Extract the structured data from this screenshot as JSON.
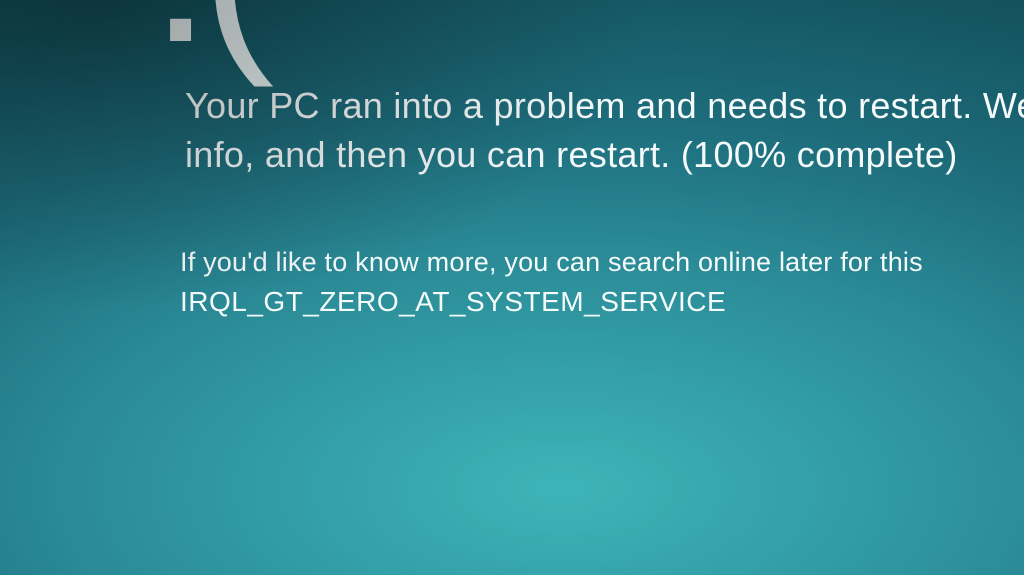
{
  "bsod": {
    "frown": ":(",
    "line1": "Your PC ran into a problem and needs to restart. We're",
    "line2": "info, and then you can restart. (100% complete)",
    "searchLine": "If you'd like to know more, you can search online later for this",
    "errorCode": "IRQL_GT_ZERO_AT_SYSTEM_SERVICE"
  }
}
